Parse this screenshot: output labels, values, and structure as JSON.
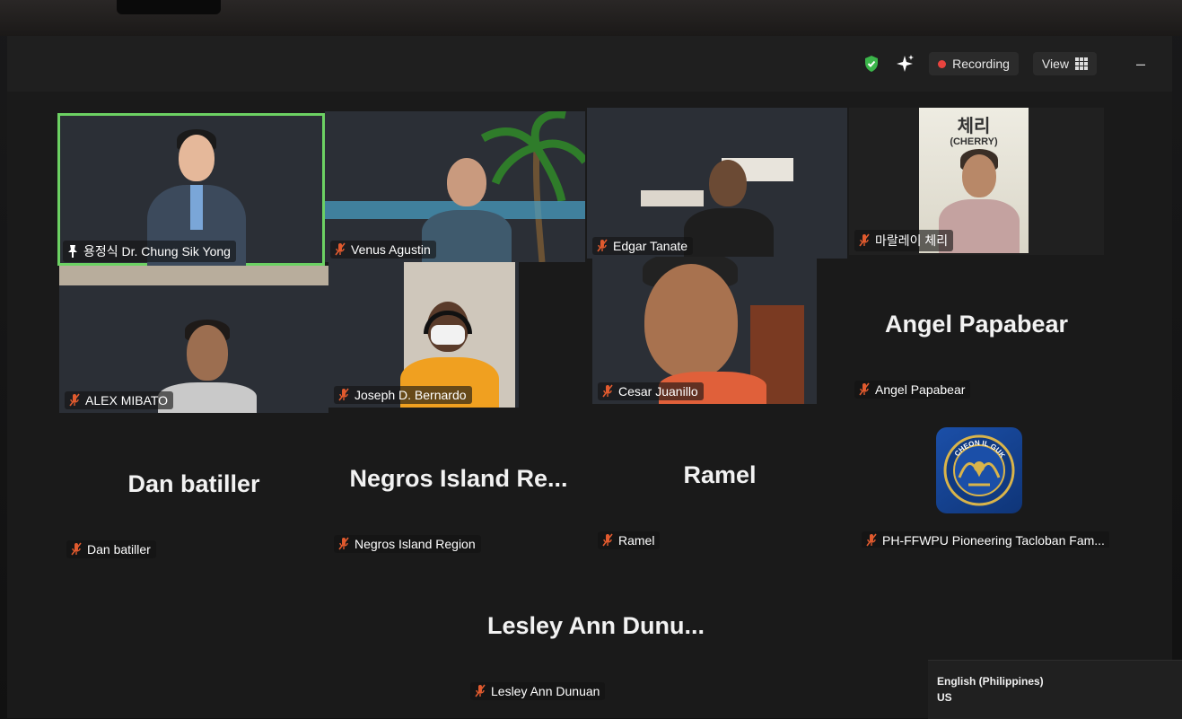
{
  "topbar": {
    "recording_label": "Recording",
    "view_label": "View",
    "minimize_glyph": "–",
    "icons": [
      "shield-check-icon",
      "sparkle-icon",
      "recording-dot-icon",
      "grid-icon",
      "minimize-icon"
    ]
  },
  "participants": [
    {
      "name": "용정식 Dr. Chung Sik Yong",
      "video": true,
      "pinned": true,
      "active_speaker": true
    },
    {
      "name": "Venus Agustin",
      "video": true,
      "muted": true
    },
    {
      "name": "Edgar Tanate",
      "video": true,
      "muted": true
    },
    {
      "name": "마랄레이 체리",
      "video": true,
      "muted": true,
      "background_sign": {
        "korean": "체리",
        "english": "(CHERRY)"
      }
    },
    {
      "name": "ALEX MIBATO",
      "video": true,
      "muted": true
    },
    {
      "name": "Joseph D. Bernardo",
      "video": true,
      "muted": true
    },
    {
      "name": "Cesar Juanillo",
      "video": true,
      "muted": true
    },
    {
      "name": "Angel Papabear",
      "display_name": "Angel Papabear",
      "video": false,
      "muted": true
    },
    {
      "name": "Dan batiller",
      "display_name": "Dan batiller",
      "video": false,
      "muted": true
    },
    {
      "name": "Negros Island Region",
      "display_name": "Negros Island Re...",
      "video": false,
      "muted": true
    },
    {
      "name": "Ramel",
      "display_name": "Ramel",
      "video": false,
      "muted": true
    },
    {
      "name": "PH-FFWPU Pioneering Tacloban Fam...",
      "video": false,
      "muted": true,
      "avatar": "church-logo",
      "logo_text": "CHEON IL GUK"
    },
    {
      "name": "Lesley Ann Dunuan",
      "display_name": "Lesley Ann Dunu...",
      "video": false,
      "muted": true
    }
  ],
  "language_popup": {
    "language": "English (Philippines)",
    "layout": "US"
  },
  "colors": {
    "active_speaker_border": "#6cd163",
    "recording_dot": "#e8433e",
    "mute_icon": "#e05a2e",
    "shield": "#3bb54a"
  }
}
